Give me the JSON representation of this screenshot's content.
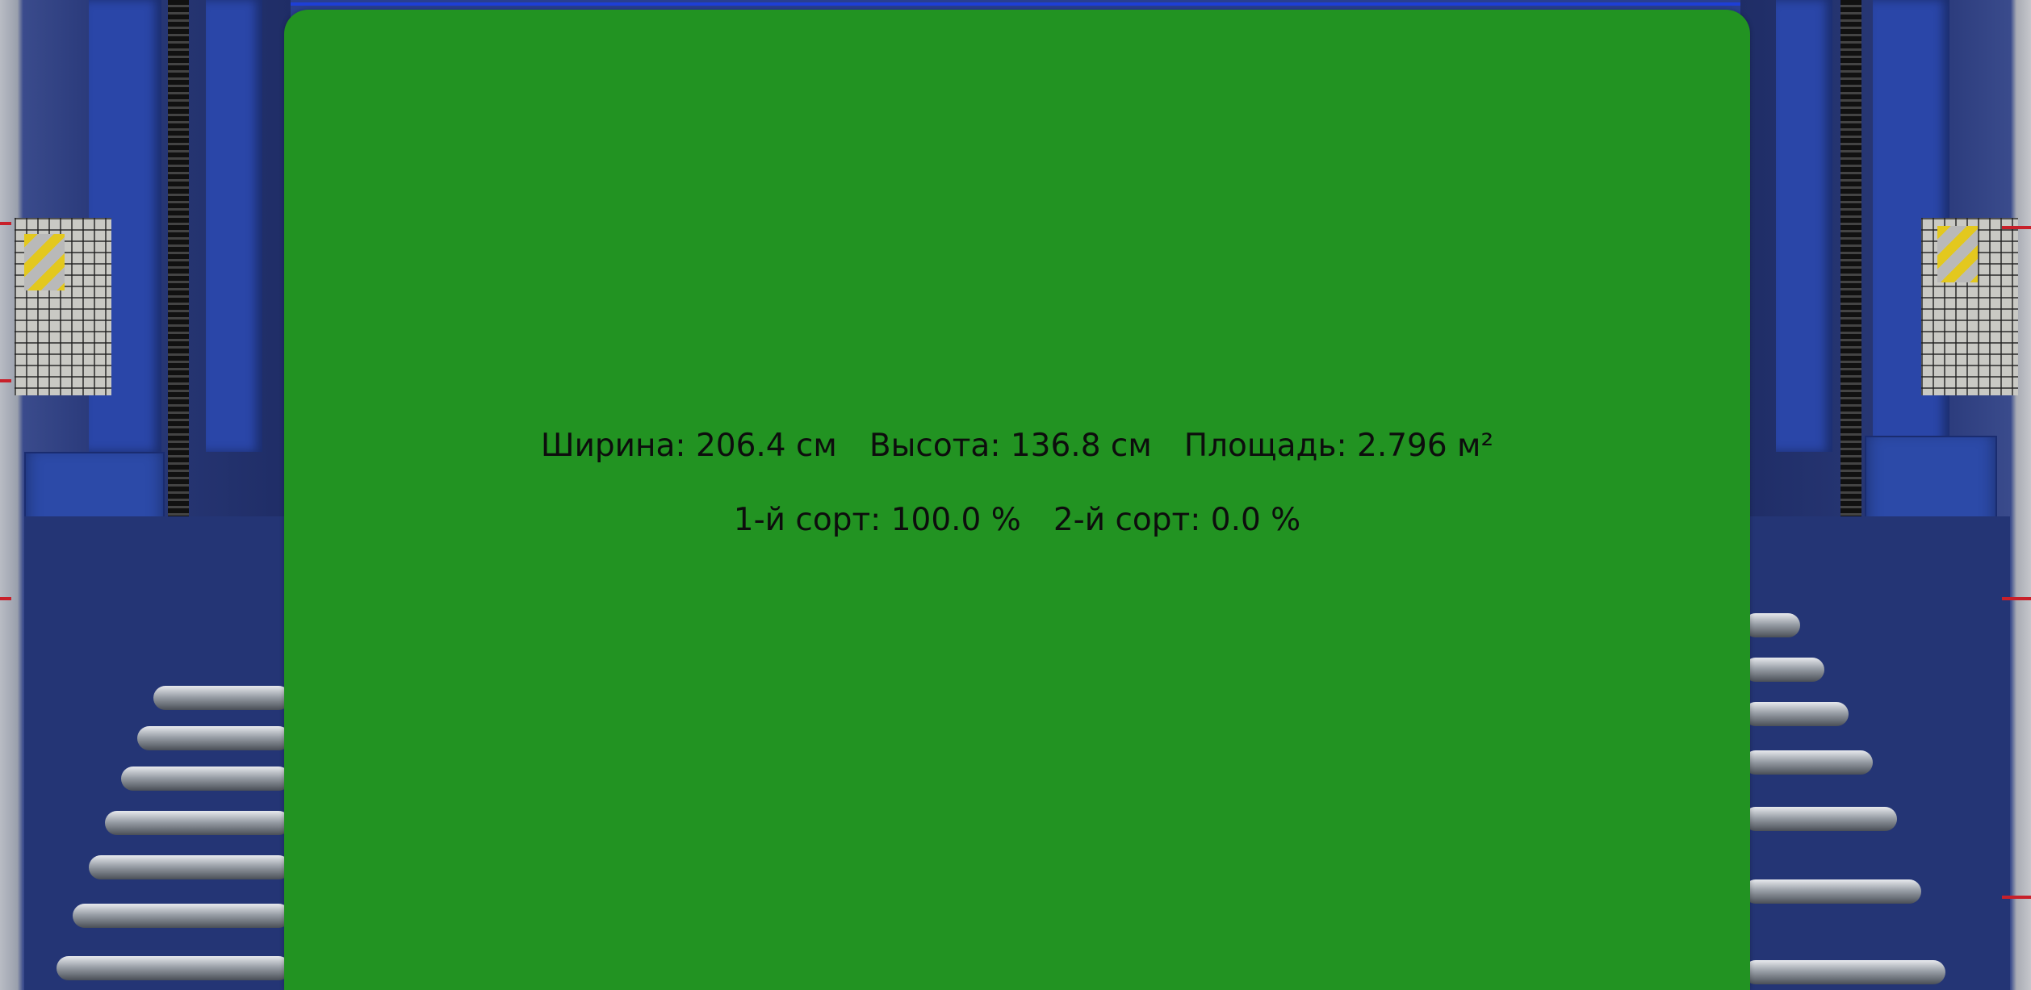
{
  "overlay": {
    "row1": {
      "width_label": "Ширина: 206.4 см",
      "height_label": "Высота: 136.8 см",
      "area_label": "Площадь: 2.796 м²"
    },
    "row2": {
      "grade1_label": "1-й сорт: 100.0 %",
      "grade2_label": "2-й сорт: 0.0 %"
    }
  },
  "colors": {
    "overlay_green": "#229322",
    "text": "#0d0d0d",
    "frame_blue": "#1e3fd6"
  }
}
